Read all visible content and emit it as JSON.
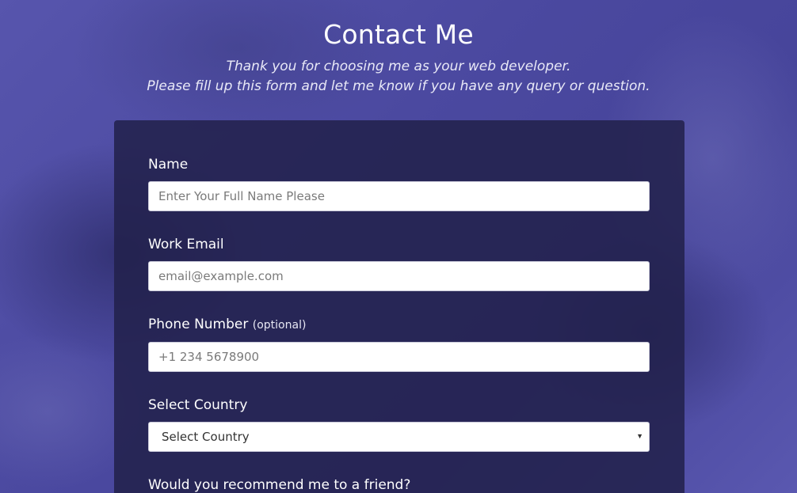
{
  "header": {
    "title": "Contact Me",
    "subtitle_line1": "Thank you for choosing me as your web developer.",
    "subtitle_line2": "Please fill up this form and let me know if you have any query or question."
  },
  "form": {
    "name": {
      "label": "Name",
      "placeholder": "Enter Your Full Name Please",
      "value": ""
    },
    "email": {
      "label": "Work Email",
      "placeholder": "email@example.com",
      "value": ""
    },
    "phone": {
      "label": "Phone Number",
      "optional_note": "(optional)",
      "placeholder": "+1 234 5678900",
      "value": ""
    },
    "country": {
      "label": "Select Country",
      "selected": "Select Country"
    },
    "recommend": {
      "label": "Would you recommend me to a friend?"
    }
  },
  "colors": {
    "background": "#4a4a9e",
    "card": "#22214b",
    "text": "#ffffff"
  },
  "icons": {
    "select_arrow": "chevron-down-icon"
  }
}
